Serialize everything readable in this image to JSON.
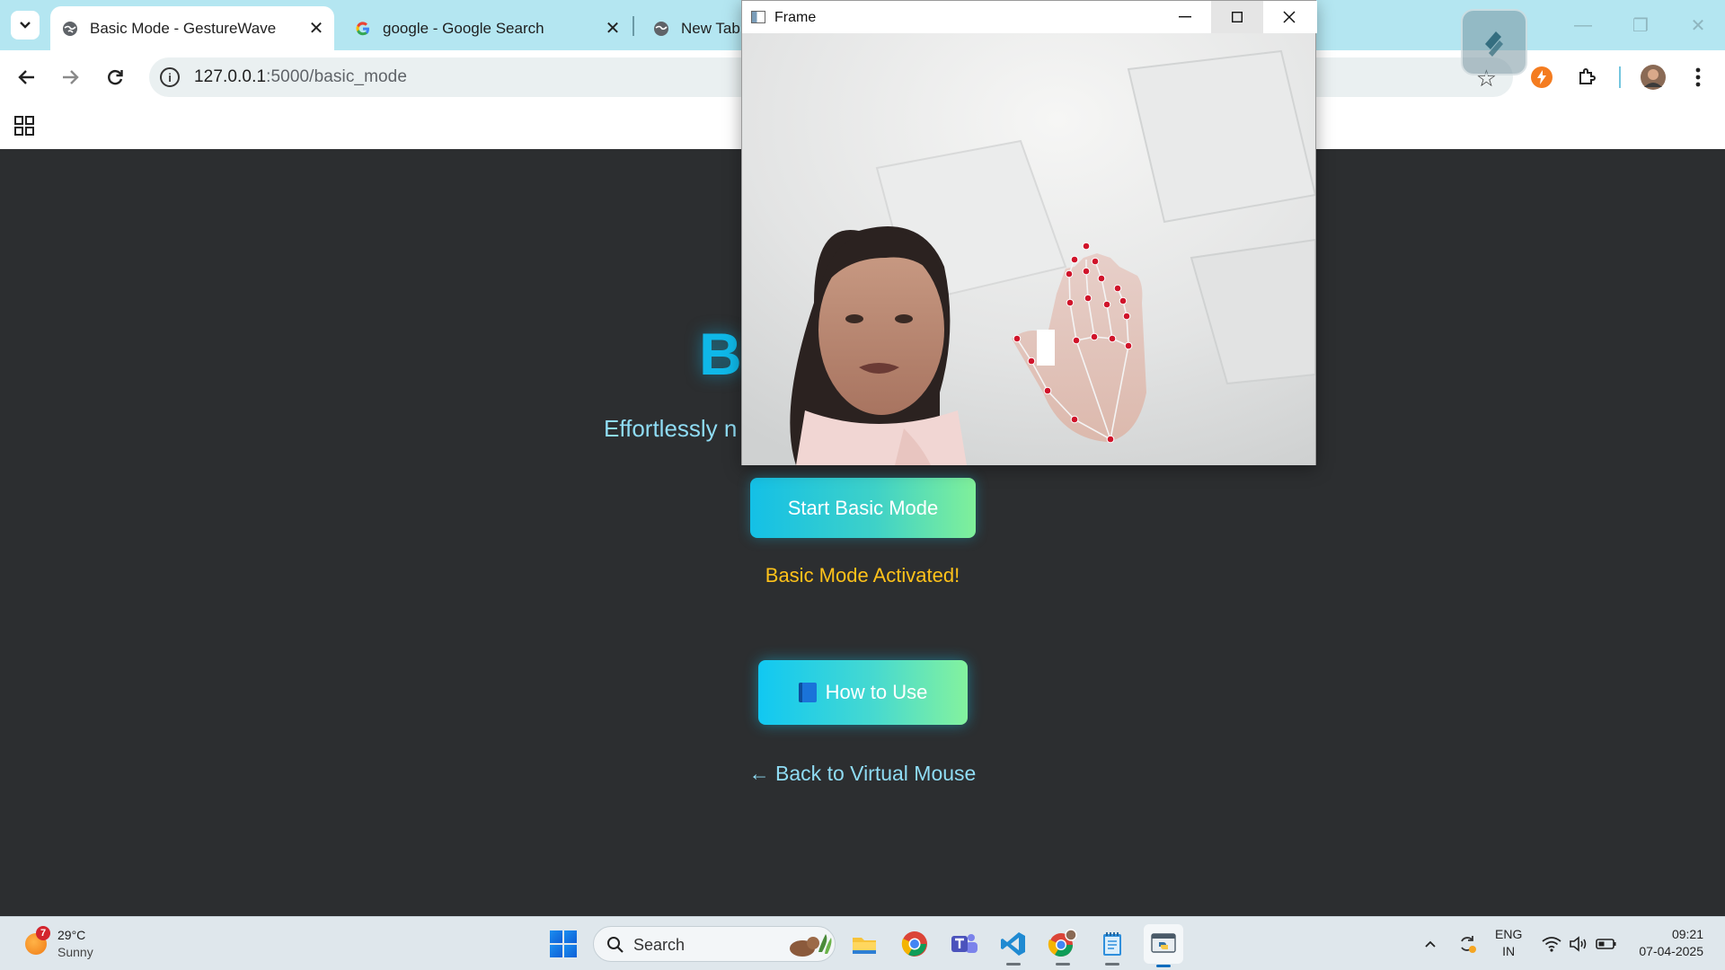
{
  "browser": {
    "tabs": [
      {
        "title": "Basic Mode - GestureWave",
        "icon": "globe-icon",
        "active": true
      },
      {
        "title": "google - Google Search",
        "icon": "google-icon",
        "active": false
      },
      {
        "title": "New Tab",
        "icon": "globe-icon",
        "active": false
      }
    ],
    "url_host": "127.0.0.1",
    "url_path": ":5000/basic_mode"
  },
  "page": {
    "hero_title": "B",
    "subtitle": "Effortlessly n",
    "start_button": "Start Basic Mode",
    "status": "Basic Mode Activated!",
    "howto_button": "How to Use",
    "back_link": "← Back to Virtual Mouse"
  },
  "frame_window": {
    "title": "Frame"
  },
  "taskbar": {
    "weather_temp": "29°C",
    "weather_condition": "Sunny",
    "weather_badge": "7",
    "search_label": "Search",
    "lang_line1": "ENG",
    "lang_line2": "IN",
    "time": "09:21",
    "date": "07-04-2025"
  },
  "colors": {
    "accent": "#0fb8e8",
    "status": "#ffc21a",
    "page_bg": "#2c2e30",
    "tabstrip": "#b4e6f1"
  }
}
